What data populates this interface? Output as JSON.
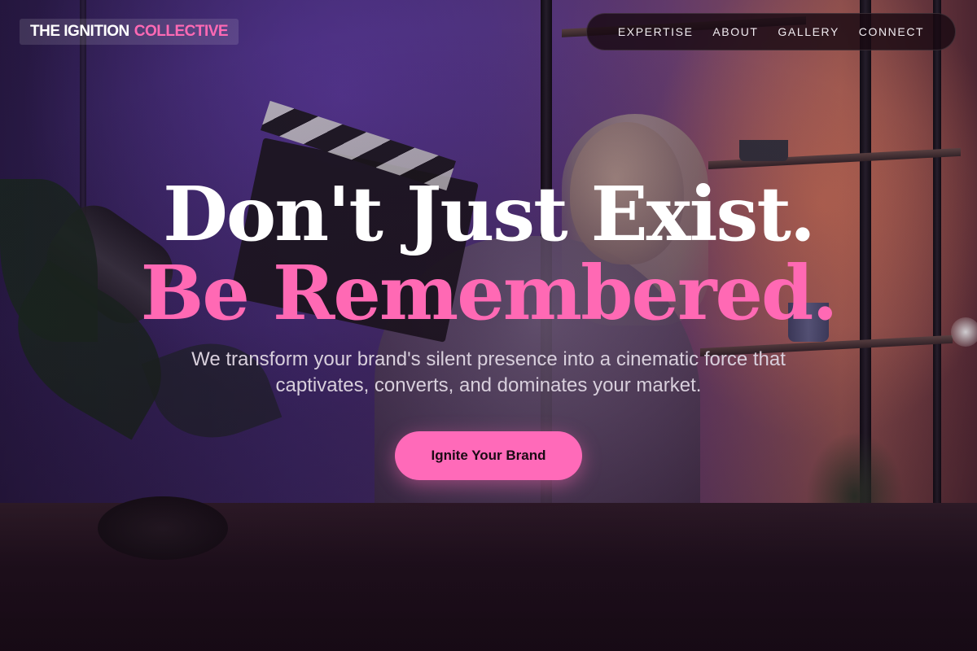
{
  "brand": {
    "name_primary": "THE IGNITION",
    "name_accent": "COLLECTIVE",
    "accent_color": "#ff69b4"
  },
  "nav": {
    "items": [
      {
        "label": "EXPERTISE"
      },
      {
        "label": "ABOUT"
      },
      {
        "label": "GALLERY"
      },
      {
        "label": "CONNECT"
      }
    ]
  },
  "hero": {
    "headline_line1": "Don't Just Exist.",
    "headline_line2": "Be Remembered.",
    "subheading_line1": "We transform your brand's silent presence into a cinematic force that",
    "subheading_line2": "captivates, converts, and dominates your market.",
    "cta_label": "Ignite Your Brand",
    "background_image": "person-holding-clapperboard-in-studio"
  }
}
